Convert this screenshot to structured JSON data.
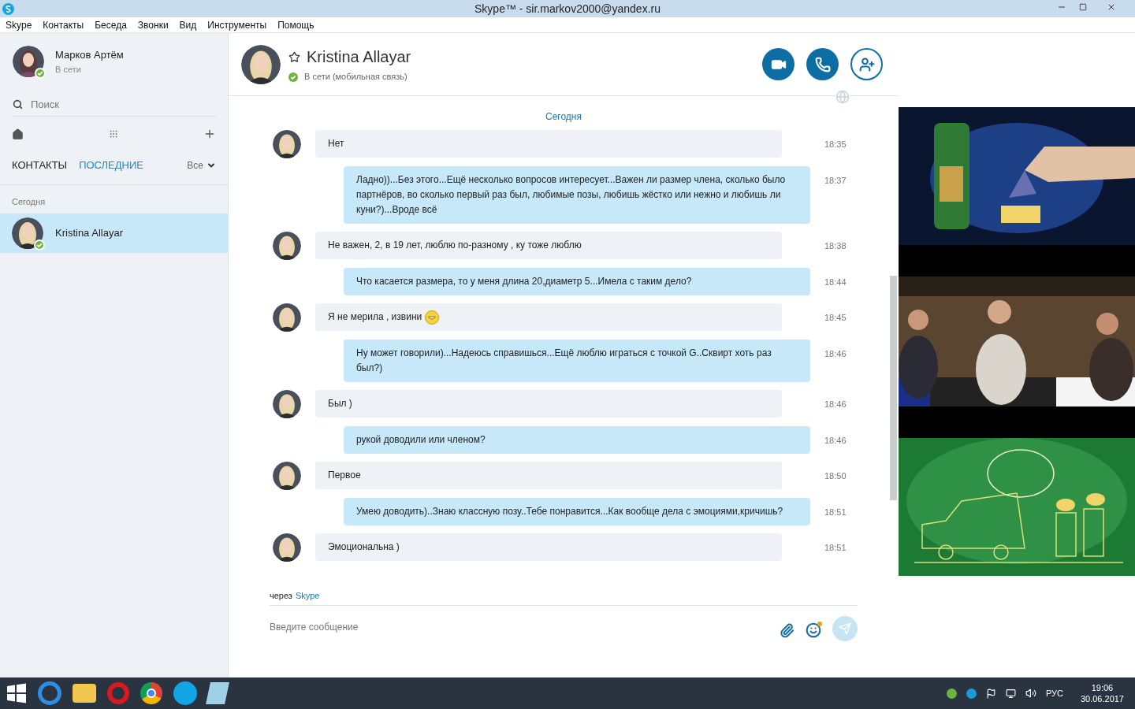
{
  "window": {
    "title": "Skype™ - sir.markov2000@yandex.ru"
  },
  "menu": [
    "Skype",
    "Контакты",
    "Беседа",
    "Звонки",
    "Вид",
    "Инструменты",
    "Помощь"
  ],
  "profile": {
    "name": "Марков Артём",
    "status": "В сети",
    "online": true
  },
  "search": {
    "placeholder": "Поиск"
  },
  "tabs": [
    {
      "label": "КОНТАКТЫ",
      "selected": false
    },
    {
      "label": "ПОСЛЕДНИЕ",
      "selected": true
    }
  ],
  "filter": "Все",
  "recent": {
    "group": "Сегодня",
    "items": [
      {
        "name": "Kristina Allayar",
        "selected": true,
        "online": true
      }
    ]
  },
  "chat": {
    "name": "Kristina Allayar",
    "status": "В сети (мобильная связь)",
    "online": true,
    "day": "Сегодня",
    "messages": [
      {
        "kind": "in",
        "text": "Нет",
        "time": "18:35",
        "emoji": false
      },
      {
        "kind": "out",
        "text": "Ладно))...Без этого...Ещё несколько вопросов интересует...Важен ли размер члена, сколько было партнёров, во сколько первый раз был, любимые позы, любишь жёстко или нежно и любишь ли куни?)...Вроде всё",
        "time": "18:37",
        "emoji": false
      },
      {
        "kind": "in",
        "text": "Не важен, 2, в 19 лет, люблю по-разному , ку тоже люблю",
        "time": "18:38",
        "emoji": false
      },
      {
        "kind": "out",
        "text": "Что касается размера, то у меня длина 20,диаметр 5...Имела с таким дело?",
        "time": "18:44",
        "emoji": false
      },
      {
        "kind": "in",
        "text": "Я не мерила , извини",
        "time": "18:45",
        "emoji": true
      },
      {
        "kind": "out",
        "text": "Ну может говорили)...Надеюсь справишься...Ещё люблю играться с точкой G..Сквирт хоть раз был?)",
        "time": "18:46",
        "emoji": false
      },
      {
        "kind": "in",
        "text": "Был )",
        "time": "18:46",
        "emoji": false
      },
      {
        "kind": "out",
        "text": "рукой доводили или членом?",
        "time": "18:46",
        "emoji": false
      },
      {
        "kind": "in",
        "text": "Первое",
        "time": "18:50",
        "emoji": false
      },
      {
        "kind": "out",
        "text": "Умею доводить)..Знаю классную позу..Тебе понравится...Как вообще дела с эмоциями,кричишь?",
        "time": "18:51",
        "emoji": false
      },
      {
        "kind": "in",
        "text": "Эмоциональна )",
        "time": "18:51",
        "emoji": false
      }
    ],
    "via_prefix": "через",
    "via_link": "Skype",
    "input_placeholder": "Введите сообщение"
  },
  "taskbar": {
    "language": "РУС",
    "time": "19:06",
    "date": "30.06.2017"
  }
}
